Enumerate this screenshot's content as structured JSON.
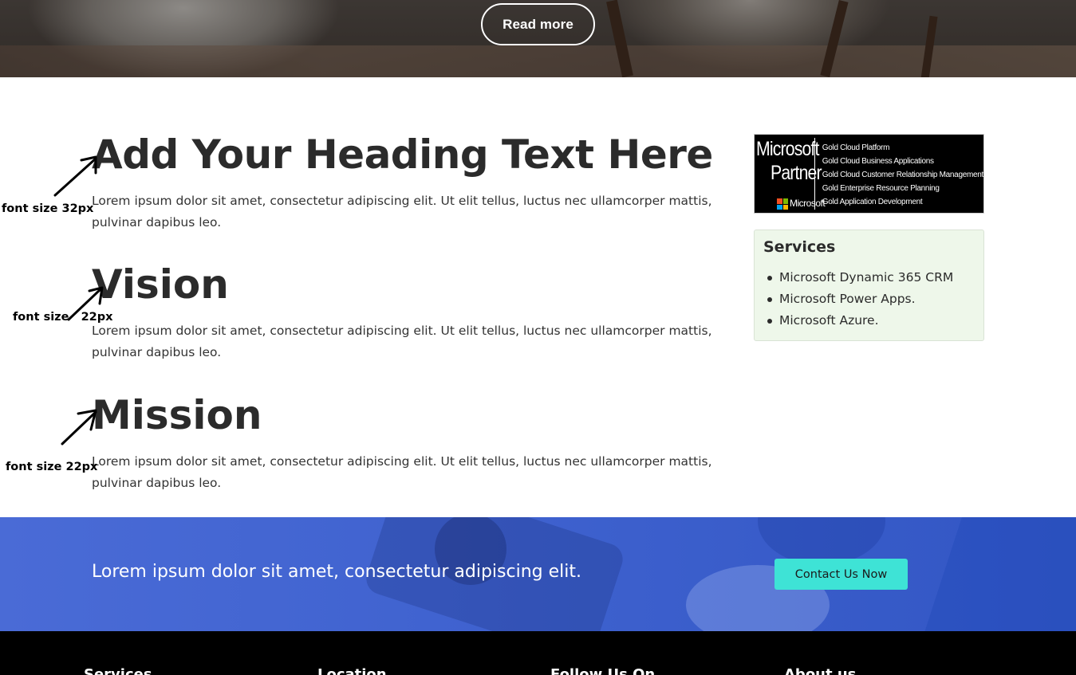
{
  "hero": {
    "read_more_label": "Read more"
  },
  "main": {
    "heading": "Add Your Heading Text Here",
    "heading_paragraph": "Lorem ipsum dolor sit amet, consectetur adipiscing elit. Ut elit tellus, luctus nec ullamcorper mattis, pulvinar dapibus leo.",
    "vision_title": "Vision",
    "vision_paragraph": "Lorem ipsum dolor sit amet, consectetur adipiscing elit. Ut elit tellus, luctus nec ullamcorper mattis, pulvinar dapibus leo.",
    "mission_title": "Mission",
    "mission_paragraph": "Lorem ipsum dolor sit amet, consectetur adipiscing elit. Ut elit tellus, luctus nec ullamcorper mattis, pulvinar dapibus leo."
  },
  "annotations": {
    "heading_note": "font size 32px",
    "vision_note": "font size   22px",
    "mission_note": "font size 22px"
  },
  "partner_badge": {
    "brand_line1": "Microsoft",
    "brand_line2": "Partner",
    "logo_word": "Microsoft",
    "competencies": [
      "Gold Cloud Platform",
      "Gold Cloud Business Applications",
      "Gold Cloud Customer Relationship Management",
      "Gold Enterprise Resource Planning",
      "Gold Application Development"
    ]
  },
  "services": {
    "title": "Services",
    "items": [
      "Microsoft Dynamic 365 CRM",
      "Microsoft Power Apps.",
      "Microsoft Azure."
    ]
  },
  "cta": {
    "text": "Lorem ipsum dolor sit amet, consectetur adipiscing elit.",
    "button_label": "Contact Us Now",
    "button_color": "#3ee3d6",
    "background_color": "#3f62cf"
  },
  "footer": {
    "headings": [
      "Services",
      "Location",
      "Follow Us On",
      "About us"
    ]
  }
}
